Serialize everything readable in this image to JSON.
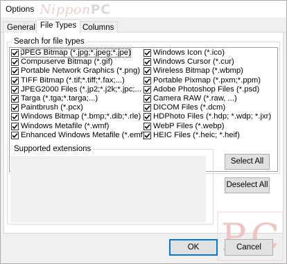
{
  "window": {
    "title": "Options"
  },
  "watermark": {
    "text": "Nippon",
    "pc": "PC",
    "big": "P.C"
  },
  "tabs": [
    {
      "label": "General",
      "active": false
    },
    {
      "label": "File Types",
      "active": true
    },
    {
      "label": "Columns",
      "active": false
    }
  ],
  "search_group": {
    "label": "Search for file types",
    "left_items": [
      {
        "label": "JPEG Bitmap (*.jpg;*.jpeg;*.jpe)",
        "checked": true,
        "focused": true
      },
      {
        "label": "Compuserve Bitmap (*.gif)",
        "checked": true
      },
      {
        "label": "Portable Network Graphics (*.png)",
        "checked": true
      },
      {
        "label": "TIFF Bitmap (*.tif;*.tiff;*.fax;...)",
        "checked": true
      },
      {
        "label": "JPEG2000 Files (*.jp2;*.j2k;*.jpc;...",
        "checked": true
      },
      {
        "label": "Targa (*.tga;*.targa;...)",
        "checked": true
      },
      {
        "label": "Paintbrush (*.pcx)",
        "checked": true
      },
      {
        "label": "Windows Bitmap (*.bmp;*.dib;*.rle)",
        "checked": true
      },
      {
        "label": "Windows Metafile (*.wmf)",
        "checked": true
      },
      {
        "label": "Enhanced Windows Metafile (*.emf)",
        "checked": true
      }
    ],
    "right_items": [
      {
        "label": "Windows Icon (*.ico)",
        "checked": true
      },
      {
        "label": "Windows Cursor (*.cur)",
        "checked": true
      },
      {
        "label": "Wireless Bitmap (*.wbmp)",
        "checked": true
      },
      {
        "label": "Portable Pixmap (*.pxm;*.ppm)",
        "checked": true
      },
      {
        "label": "Adobe Photoshop Files (*.psd)",
        "checked": true
      },
      {
        "label": "Camera RAW (*.raw, ...)",
        "checked": true
      },
      {
        "label": "DICOM Files (*.dcm)",
        "checked": true
      },
      {
        "label": "HDPhoto Files (*.hdp; *.wdp; *.jxr)",
        "checked": true
      },
      {
        "label": "WebP Files (*.webp)",
        "checked": true
      },
      {
        "label": "HEIC Files (*.heic; *.heif)",
        "checked": true
      }
    ]
  },
  "supported": {
    "label": "Supported extensions",
    "value": ""
  },
  "buttons": {
    "select_all": "Select All",
    "deselect_all": "Deselect All",
    "ok": "OK",
    "cancel": "Cancel"
  },
  "colors": {
    "focus_border": "#0078d7",
    "watermark": "#e6b3b3"
  }
}
